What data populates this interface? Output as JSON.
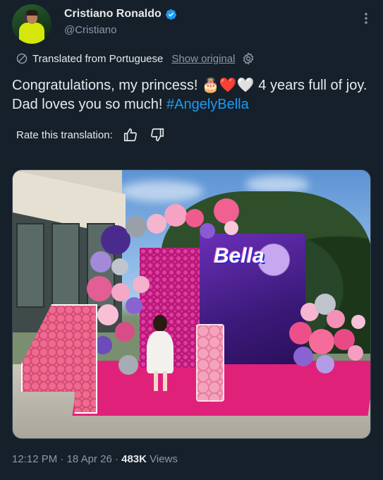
{
  "author": {
    "name": "Cristiano Ronaldo",
    "handle": "@Cristiano",
    "verified": true
  },
  "translation": {
    "label": "Translated from Portuguese",
    "show_original": "Show original",
    "rate_label": "Rate this translation:"
  },
  "tweet": {
    "text_before": "Congratulations, my princess! 🎂❤️🤍 4 years full of joy. Dad loves you so much! ",
    "hashtag": "#AngelyBella"
  },
  "media": {
    "backdrop_text": "Bella"
  },
  "meta": {
    "time": "12:12 PM",
    "separator1": " · ",
    "date": "18 Apr 26",
    "separator2": " · ",
    "views": "483K",
    "views_label": " Views"
  },
  "colors": {
    "background": "#15202b",
    "text": "#e7e9ea",
    "muted": "#8b98a5",
    "accent": "#1d9bf0"
  },
  "icons": {
    "verified": "verified-badge-icon",
    "more": "more-dots-icon",
    "translate": "translate-icon",
    "settings": "gear-icon",
    "thumbs_up": "thumbs-up-icon",
    "thumbs_down": "thumbs-down-icon"
  }
}
